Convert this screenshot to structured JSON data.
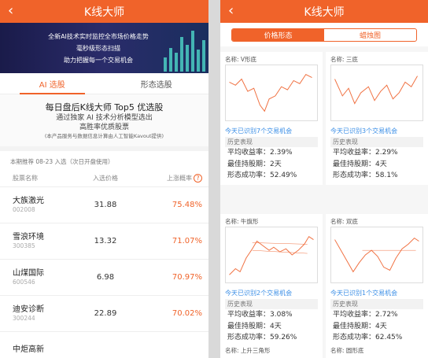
{
  "left": {
    "title": "K线大师",
    "banner": [
      "全新AI技术实时监控全市场价格走势",
      "毫秒级形态扫描",
      "助力把握每一个交易机会"
    ],
    "tabs": [
      "AI 选股",
      "形态选股"
    ],
    "intro": {
      "title": "每日盘后K线大师 Top5 优选股",
      "line1": "通过独家 AI 技术分析模型选出",
      "line2": "高胜率优质股票",
      "note": "(本产品服务与数据信息计算由人工智能Kavout提供)"
    },
    "recommend": "本期推荐 08-23 入选（次日开盘使用）",
    "headers": {
      "name": "股票名称",
      "price": "入选价格",
      "rate": "上涨概率"
    },
    "stocks": [
      {
        "name": "大族激光",
        "code": "002008",
        "price": "31.88",
        "rate": "75.48%"
      },
      {
        "name": "雪浪环境",
        "code": "300385",
        "price": "13.32",
        "rate": "71.07%"
      },
      {
        "name": "山煤国际",
        "code": "600546",
        "price": "6.98",
        "rate": "70.97%"
      },
      {
        "name": "迪安诊断",
        "code": "300244",
        "price": "22.89",
        "rate": "70.02%"
      },
      {
        "name": "中炬高新",
        "code": "",
        "price": "",
        "rate": ""
      }
    ]
  },
  "right": {
    "title": "K线大师",
    "tabs": [
      "价格形态",
      "蜡烛图"
    ],
    "history_label": "历史表现",
    "stat_labels": [
      "平均收益率：",
      "最佳持股期：",
      "形态成功率："
    ],
    "patterns": [
      {
        "name": "名称: V形底",
        "link": "今天已识别7个交易机会",
        "stats": [
          "2.39%",
          "2天",
          "52.49%"
        ]
      },
      {
        "name": "名称: 三底",
        "link": "今天已识别3个交易机会",
        "stats": [
          "2.29%",
          "4天",
          "58.1%"
        ]
      },
      {
        "name": "名称: 牛旗形",
        "link": "今天已识别2个交易机会",
        "stats": [
          "3.08%",
          "4天",
          "59.26%"
        ]
      },
      {
        "name": "名称: 双底",
        "link": "今天已识别1个交易机会",
        "stats": [
          "2.72%",
          "4天",
          "62.45%"
        ]
      },
      {
        "name": "名称: 上升三角形"
      },
      {
        "name": "名称: 圆形底"
      }
    ]
  },
  "colors": {
    "accent": "#f0632a",
    "link": "#3a8ee6",
    "banner": "#1a1b4a"
  }
}
